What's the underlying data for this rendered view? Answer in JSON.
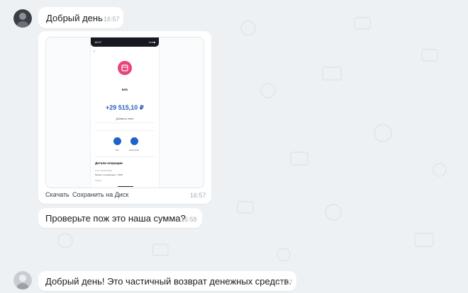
{
  "messages": [
    {
      "text": "Добрый день",
      "time": "16:57"
    },
    {
      "attachment": {
        "status_time": "16:07",
        "status_icons": "▾ ▾ ■",
        "back": "‹",
        "merchant": "ВЛБ",
        "amount": "+29 515,10 ₽",
        "amount_sub": "Добавить ответ",
        "btn_1": "Чек",
        "btn_2": "Категория",
        "section_title": "Детали операции",
        "detail_label": "Счёт зачисления",
        "detail_value": "Расчёт и за крупные т. СМЛ",
        "detail_extra": "Статус"
      },
      "actions": {
        "download": "Скачать",
        "save": "Сохранить на Диск"
      },
      "time": "16:57"
    },
    {
      "text": "Проверьте пож это наша сумма?",
      "time": "16:58"
    },
    {
      "text": "Добрый день! Это частичный возврат денежных средств.",
      "time": "17:07"
    }
  ],
  "colors": {
    "background": "#eef1f4",
    "bubble": "#ffffff",
    "amount": "#2a5fb7",
    "merchant_icon": "#e8457a",
    "action_button": "#1e63c9"
  }
}
